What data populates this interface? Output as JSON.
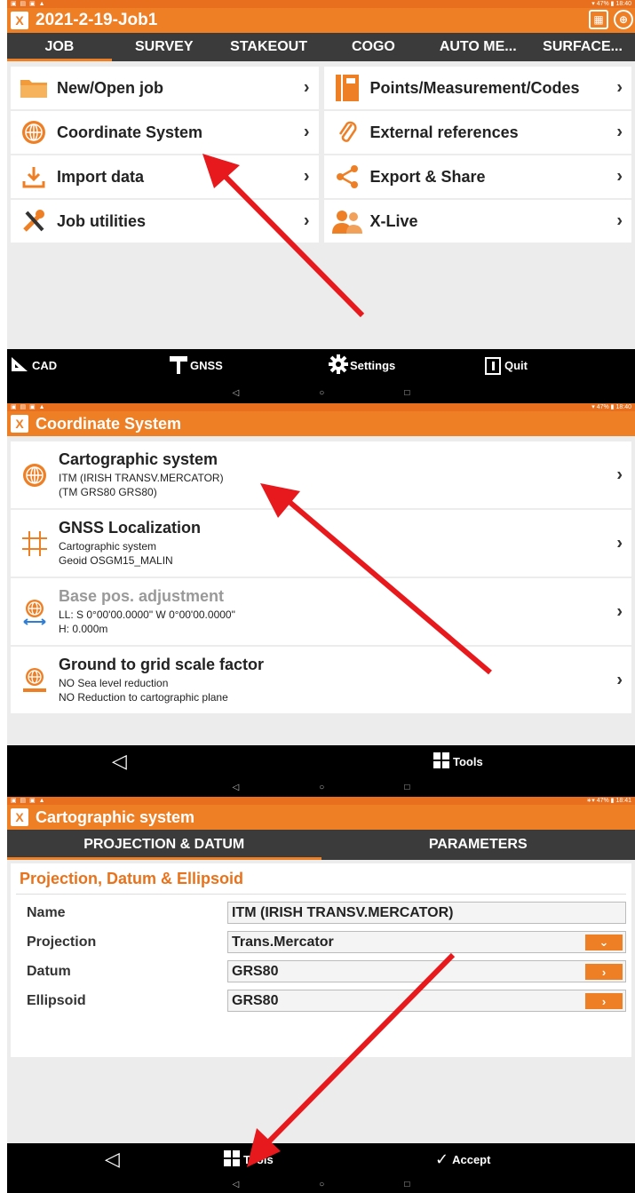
{
  "colors": {
    "accent": "#ef7f25",
    "tab_bg": "#3b3b3b",
    "arrow": "#e8191c"
  },
  "status": {
    "left_icons": "▣ ▤ ▣ ▲",
    "right_1": "▾ 47% ▮ 18:40",
    "right_2": "▾ 47% ▮ 18:40",
    "right_3": "∗▾ 47% ▮ 18:41"
  },
  "screen1": {
    "title": "2021-2-19-Job1",
    "tabs": [
      "JOB",
      "SURVEY",
      "STAKEOUT",
      "COGO",
      "AUTO ME...",
      "SURFACE..."
    ],
    "menu": [
      {
        "label": "New/Open job",
        "icon": "folder-icon"
      },
      {
        "label": "Points/Measurement/Codes",
        "icon": "notebook-icon"
      },
      {
        "label": "Coordinate System",
        "icon": "globe-icon"
      },
      {
        "label": "External references",
        "icon": "paperclip-icon"
      },
      {
        "label": "Import data",
        "icon": "download-icon"
      },
      {
        "label": "Export & Share",
        "icon": "share-icon"
      },
      {
        "label": "Job utilities",
        "icon": "tools-icon"
      },
      {
        "label": "X-Live",
        "icon": "users-icon"
      }
    ],
    "bottom": {
      "cad": "CAD",
      "gnss": "GNSS",
      "settings": "Settings",
      "quit": "Quit"
    }
  },
  "screen2": {
    "title": "Coordinate System",
    "items": [
      {
        "title": "Cartographic system",
        "line1": "ITM (IRISH TRANSV.MERCATOR)",
        "line2": "(TM GRS80 GRS80)",
        "icon": "globe-icon"
      },
      {
        "title": "GNSS Localization",
        "line1": "Cartographic system",
        "line2": "Geoid OSGM15_MALIN",
        "icon": "grid-icon"
      },
      {
        "title": "Base pos. adjustment",
        "line1": "LL: S 0°00'00.0000\"  W 0°00'00.0000\"",
        "line2": "H: 0.000m",
        "icon": "globe-move-icon"
      },
      {
        "title": "Ground to grid scale factor",
        "line1": "NO Sea level reduction",
        "line2": "NO Reduction to cartographic plane",
        "icon": "globe-scale-icon"
      }
    ],
    "bottom": {
      "tools": "Tools"
    }
  },
  "screen3": {
    "title": "Cartographic system",
    "tabs": [
      "PROJECTION & DATUM",
      "PARAMETERS"
    ],
    "section": "Projection, Datum & Ellipsoid",
    "rows": [
      {
        "label": "Name",
        "value": "ITM (IRISH TRANSV.MERCATOR)",
        "button": ""
      },
      {
        "label": "Projection",
        "value": "Trans.Mercator",
        "button": "⌄"
      },
      {
        "label": "Datum",
        "value": "GRS80",
        "button": "›"
      },
      {
        "label": "Ellipsoid",
        "value": "GRS80",
        "button": "›"
      }
    ],
    "bottom": {
      "tools": "Tools",
      "accept": "Accept"
    }
  },
  "nav": {
    "back": "◁",
    "home": "○",
    "recent": "□"
  }
}
